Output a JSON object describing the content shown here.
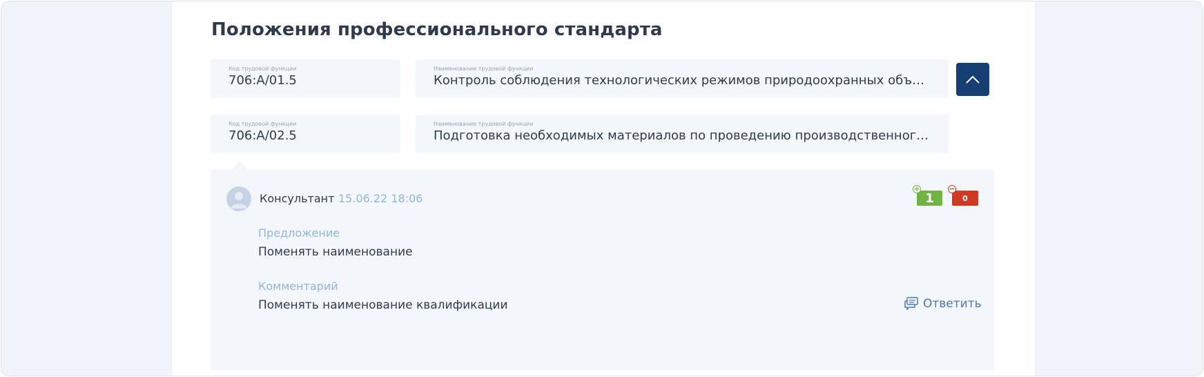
{
  "section": {
    "title": "Положения профессионального стандарта"
  },
  "functions": [
    {
      "code_label": "Код трудовой функции",
      "code": "706:A/01.5",
      "name_label": "Наименование трудовой функции",
      "name": "Контроль соблюдения технологических режимов природоохранных объектов организации"
    },
    {
      "code_label": "Код трудовой функции",
      "code": "706:A/02.5",
      "name_label": "Наименование трудовой функции",
      "name": "Подготовка необходимых материалов по проведению производственного экологического контроля"
    }
  ],
  "comment": {
    "author": "Консультант",
    "datetime": "15.06.22 18:06",
    "votes_up": "1",
    "votes_up_sign": "+",
    "votes_down": "0",
    "votes_down_sign": "−",
    "proposal_label": "Предложение",
    "proposal_text": "Поменять наименование",
    "comment_label": "Комментарий",
    "comment_text": "Поменять наименование квалификации",
    "reply_label": "Ответить"
  },
  "colors": {
    "accent": "#163f73",
    "vote_up": "#72b443",
    "vote_down": "#cf3a22",
    "muted_blue": "#93b5dc"
  },
  "icons": {
    "collapse": "chevron-up-icon",
    "avatar": "user-avatar-icon",
    "reply": "chat-bubbles-icon"
  }
}
